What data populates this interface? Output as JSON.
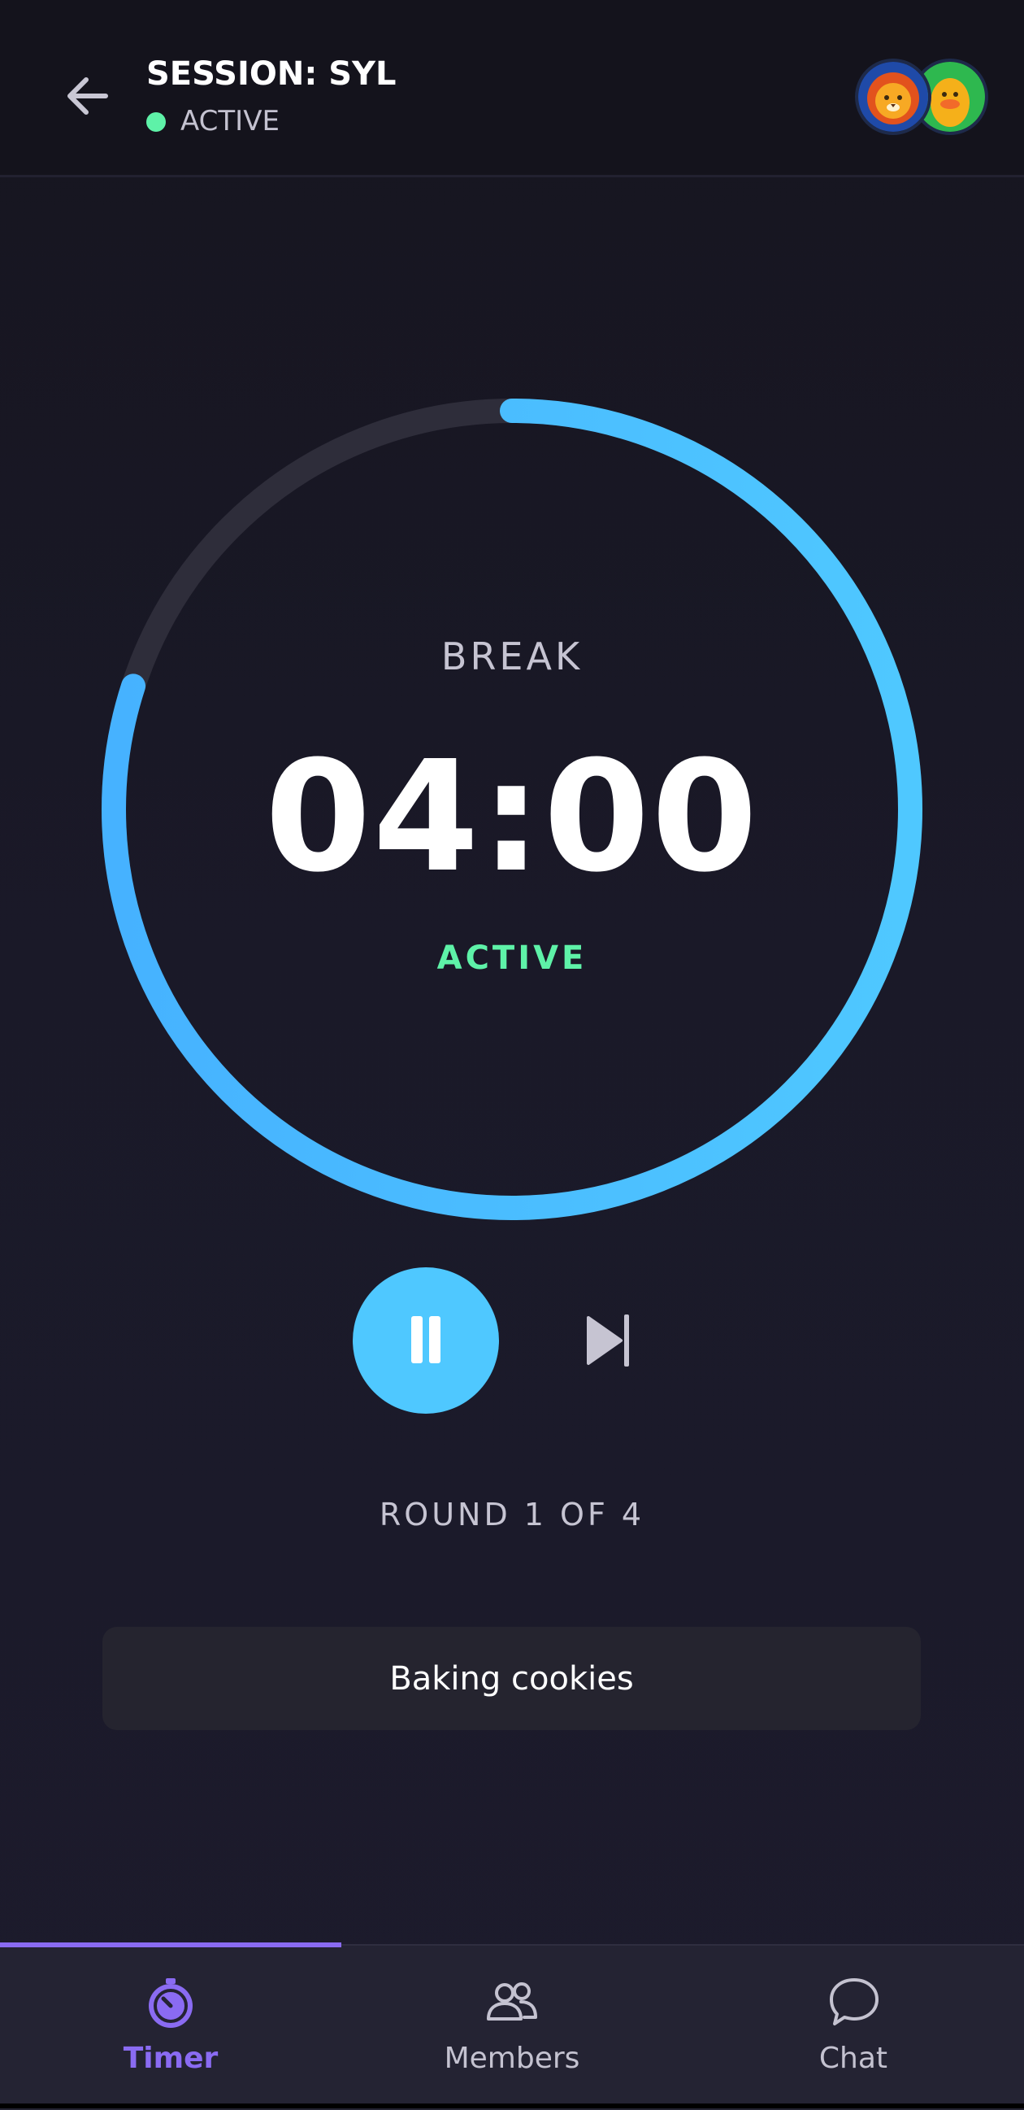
{
  "header": {
    "title": "SESSION: SYL",
    "status": "ACTIVE",
    "status_color": "#5ef2a8",
    "back_icon": "arrow-left-icon",
    "avatars": [
      "lion-avatar",
      "duck-avatar"
    ]
  },
  "timer": {
    "phase": "BREAK",
    "time": "04:00",
    "state": "ACTIVE",
    "progress_fraction": 0.8,
    "ring_color": "#4fc8ff",
    "track_color": "#2e2d3a"
  },
  "controls": {
    "pause_icon": "pause-icon",
    "skip_icon": "skip-next-icon"
  },
  "round": "ROUND 1 OF 4",
  "task": "Baking cookies",
  "tabs": [
    {
      "label": "Timer",
      "icon": "timer-icon",
      "active": true
    },
    {
      "label": "Members",
      "icon": "members-icon",
      "active": false
    },
    {
      "label": "Chat",
      "icon": "chat-icon",
      "active": false
    }
  ],
  "accent_color": "#8a6bf2"
}
